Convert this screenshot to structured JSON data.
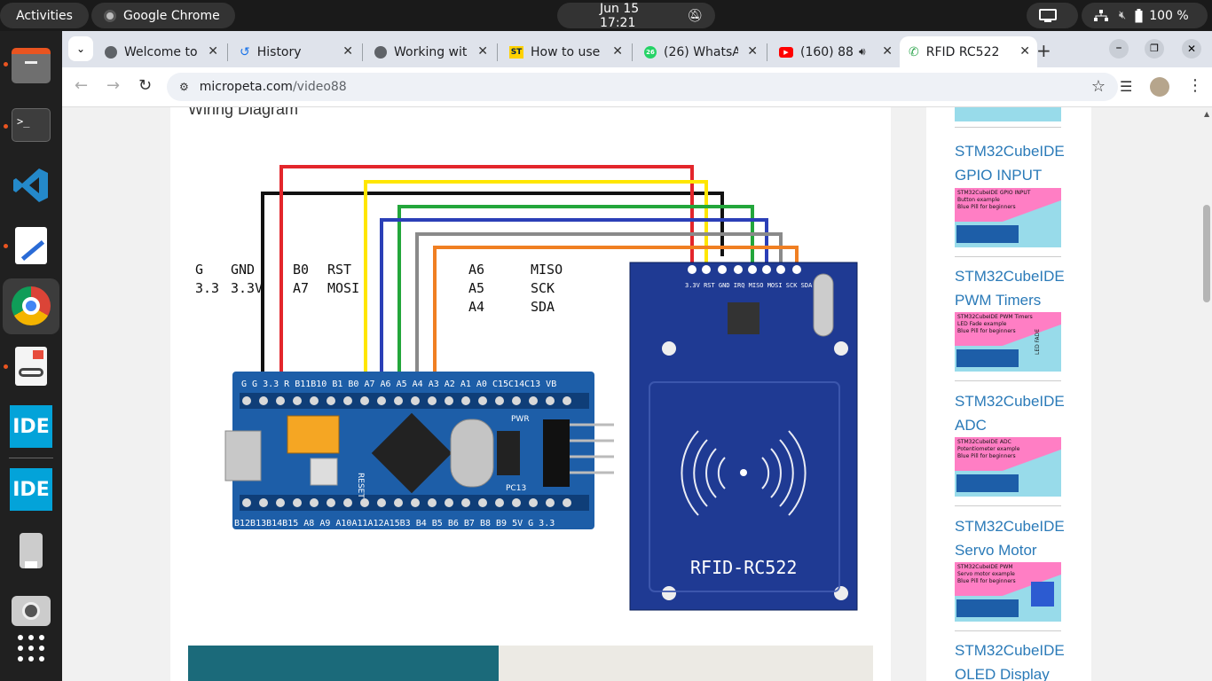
{
  "topbar": {
    "activities": "Activities",
    "app_name": "Google Chrome",
    "datetime": "Jun 15  17:21",
    "battery": "100 %"
  },
  "tabs": [
    {
      "title": "Welcome to",
      "icon": "globe-icon"
    },
    {
      "title": "History",
      "icon": "history-icon"
    },
    {
      "title": "Working wit",
      "icon": "globe-icon"
    },
    {
      "title": "How to use",
      "icon": "st-icon"
    },
    {
      "title": "(26) WhatsA",
      "icon": "whatsapp-icon",
      "badge": "26"
    },
    {
      "title": "(160) 88",
      "icon": "youtube-icon"
    },
    {
      "title": "RFID RC522",
      "icon": "phone-icon"
    }
  ],
  "address": {
    "domain": "micropeta.com",
    "path": "/video88"
  },
  "article": {
    "heading": "Wiring Diagram",
    "diagram": {
      "pin_labels": [
        {
          "col1": "G",
          "col2": "3.3"
        },
        {
          "col1": "GND",
          "col2": "3.3V"
        },
        {
          "col1": "B0",
          "col2": "A7"
        },
        {
          "col1": "RST",
          "col2": "MOSI"
        },
        {
          "col1": "A6",
          "col2": "A5",
          "col3": "A4"
        },
        {
          "col1": "MISO",
          "col2": "SCK",
          "col3": "SDA"
        }
      ],
      "board_top_pins": "G  G  3.3 R  B11B10 B1  B0 A7  A6  A5  A4  A3  A2  A1  A0 C15C14C13 VB",
      "board_bottom_pins": "B12B13B14B15 A8 A9 A10A11A12A15B3 B4  B5  B6  B7  B8  B9  5V  G  3.3",
      "board_reset": "RESET",
      "board_pwr": "PWR",
      "board_pc13": "PC13",
      "rfid_label": "RFID-RC522",
      "rfid_pins": "3.3V RST GND IRQ MISO MOSI SCK SDA",
      "wire_colors": {
        "black": "#111111",
        "red": "#e3262b",
        "yellow": "#ffe600",
        "green": "#23a63b",
        "blue": "#2b3fb7",
        "gray": "#8a8a8a",
        "orange": "#f07f22"
      }
    }
  },
  "sidebar": {
    "items": [
      {
        "line1": "STM32CubeIDE",
        "line2": "GPIO INPUT",
        "thumb": [
          "STM32CubeIDE GPIO INPUT",
          "Button example",
          "Blue Pill for beginners"
        ]
      },
      {
        "line1": "STM32CubeIDE",
        "line2": "PWM Timers",
        "thumb": [
          "STM32CubeIDE PWM Timers",
          "LED Fade example",
          "Blue Pill for beginners"
        ],
        "thumb_side": "LED FADE"
      },
      {
        "line1": "STM32CubeIDE",
        "line2": "ADC",
        "thumb": [
          "STM32CubeIDE ADC",
          "Potentiometer example",
          "Blue Pill for beginners"
        ]
      },
      {
        "line1": "STM32CubeIDE",
        "line2": "Servo Motor",
        "thumb": [
          "STM32CubeIDE PWM",
          "Servo motor example",
          "Blue Pill for beginners"
        ]
      },
      {
        "line1": "STM32CubeIDE",
        "line2": "OLED Display"
      }
    ]
  },
  "dock": [
    {
      "name": "files-icon"
    },
    {
      "name": "terminal-icon"
    },
    {
      "name": "vscode-icon"
    },
    {
      "name": "text-editor-icon"
    },
    {
      "name": "chrome-icon"
    },
    {
      "name": "document-viewer-icon"
    },
    {
      "name": "stm32cubeide-icon",
      "label": "IDE"
    },
    {
      "name": "stm32cubeide-icon",
      "label": "IDE"
    },
    {
      "name": "usb-drive-icon"
    },
    {
      "name": "camera-icon"
    },
    {
      "name": "show-apps-icon"
    }
  ]
}
